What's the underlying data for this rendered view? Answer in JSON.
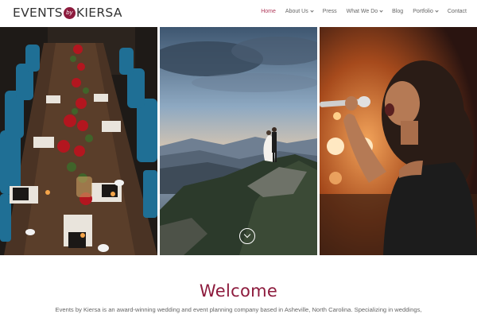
{
  "header": {
    "logo": {
      "left": "EVENTS",
      "badge": "by",
      "right": "KIERSA"
    },
    "nav": [
      {
        "label": "Home",
        "active": true,
        "dropdown": false
      },
      {
        "label": "About Us",
        "active": false,
        "dropdown": true
      },
      {
        "label": "Press",
        "active": false,
        "dropdown": false
      },
      {
        "label": "What We Do",
        "active": false,
        "dropdown": true
      },
      {
        "label": "Blog",
        "active": false,
        "dropdown": false
      },
      {
        "label": "Portfolio",
        "active": false,
        "dropdown": true
      },
      {
        "label": "Contact",
        "active": false,
        "dropdown": false
      }
    ]
  },
  "hero": {
    "photos": [
      {
        "subject": "banquet table with blue chairs and red roses"
      },
      {
        "subject": "couple on mountain at sunset"
      },
      {
        "subject": "singer performing with microphone"
      }
    ],
    "scroll_icon": "chevron-down-icon"
  },
  "welcome": {
    "title": "Welcome",
    "text": "Events by Kiersa is an award-winning wedding and event planning company based in Asheville, North Carolina. Specializing in weddings,"
  },
  "colors": {
    "brand": "#8d1b3d",
    "nav_active": "#b03a5b"
  }
}
